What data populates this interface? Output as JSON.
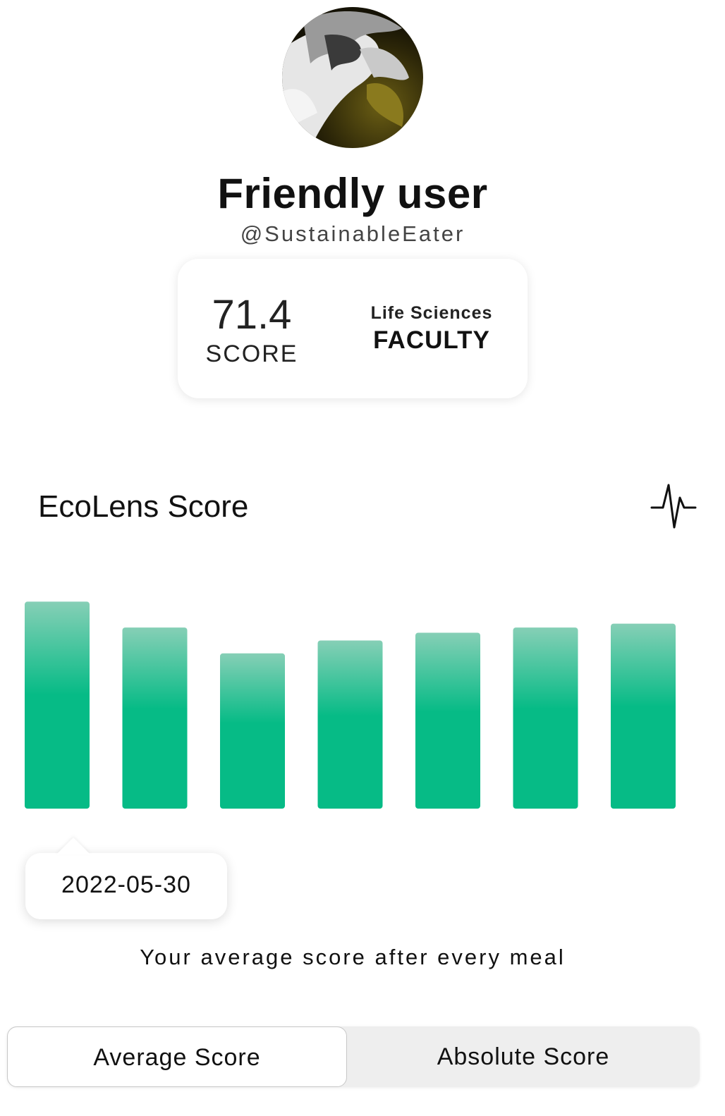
{
  "profile": {
    "display_name": "Friendly user",
    "handle": "@SustainableEater"
  },
  "stats": {
    "score_value": "71.4",
    "score_label": "SCORE",
    "faculty_name": "Life Sciences",
    "faculty_label": "FACULTY"
  },
  "section": {
    "title": "EcoLens Score",
    "icon": "pulse-icon"
  },
  "chart_data": {
    "type": "bar",
    "title": "",
    "xlabel": "",
    "ylabel": "",
    "categories": [
      "",
      "",
      "",
      "",
      "",
      "",
      ""
    ],
    "values": [
      80,
      70,
      60,
      65,
      68,
      70,
      71.5
    ],
    "ylim": [
      0,
      100
    ],
    "grid": false,
    "bar_color_top": "#86cfb6",
    "bar_color_bottom": "#06bb86",
    "selected_index": 0
  },
  "tooltip": {
    "date": "2022-05-30"
  },
  "caption": "Your average score after every meal",
  "segmented_control": {
    "options": [
      "Average Score",
      "Absolute Score"
    ],
    "selected": "Average Score"
  },
  "colors": {
    "accent": "#06bb86",
    "text": "#111111",
    "segment_bg": "#eeeeee"
  }
}
